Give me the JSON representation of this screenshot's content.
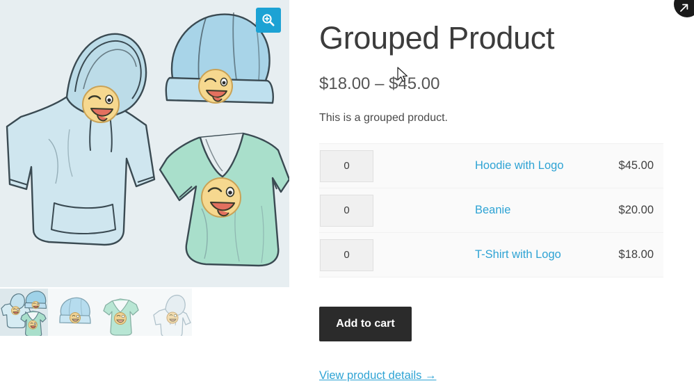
{
  "product": {
    "title": "Grouped Product",
    "price_range": "$18.00 – $45.00",
    "description": "This is a grouped product.",
    "add_to_cart_label": "Add to cart",
    "view_details_label": "View product details →"
  },
  "gallery": {
    "zoom_icon": "magnifier-plus-icon",
    "thumbnails": [
      {
        "name": "grouped-products-thumbnail",
        "active": true
      },
      {
        "name": "beanie-thumbnail",
        "active": false
      },
      {
        "name": "tshirt-thumbnail",
        "active": false
      },
      {
        "name": "hoodie-thumbnail",
        "active": false
      }
    ]
  },
  "grouped_items": [
    {
      "qty": "0",
      "label": "Hoodie with Logo",
      "price": "$45.00"
    },
    {
      "qty": "0",
      "label": "Beanie",
      "price": "$20.00"
    },
    {
      "qty": "0",
      "label": "T-Shirt with Logo",
      "price": "$18.00"
    }
  ],
  "corner_badge": {
    "icon": "arrow-up-right-icon"
  },
  "colors": {
    "accent_link": "#2ea3d4",
    "zoom_button": "#1ca2d4",
    "add_to_cart_bg": "#2b2b2b",
    "gallery_bg": "#e7eef1",
    "row_bg": "#fafafa"
  }
}
